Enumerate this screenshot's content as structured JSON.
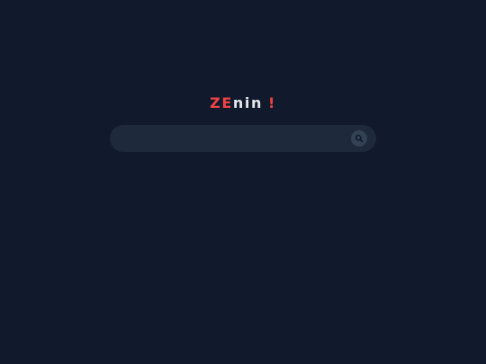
{
  "logo": {
    "part1": "ZE",
    "part2": "nin",
    "part3": "!"
  },
  "search": {
    "placeholder": "",
    "value": "",
    "button_icon": "search-icon"
  },
  "colors": {
    "background": "#101a2c",
    "search_bg": "#1e293b",
    "accent": "#ef4444",
    "text": "#e5e7eb"
  }
}
